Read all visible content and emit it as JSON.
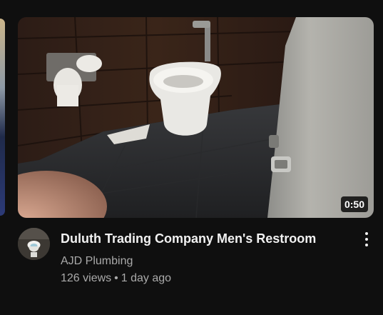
{
  "video": {
    "title": "Duluth Trading Company Men's Restroom",
    "channel": "AJD Plumbing",
    "views": "126 views",
    "separator": "•",
    "age": "1 day ago",
    "duration": "0:50"
  },
  "icons": {
    "more_actions": "vertical-ellipsis-icon",
    "avatar": "toilet-avatar-icon"
  },
  "colors": {
    "background": "#0f0f0f",
    "title": "#f1f1f1",
    "meta": "#aaaaaa"
  }
}
